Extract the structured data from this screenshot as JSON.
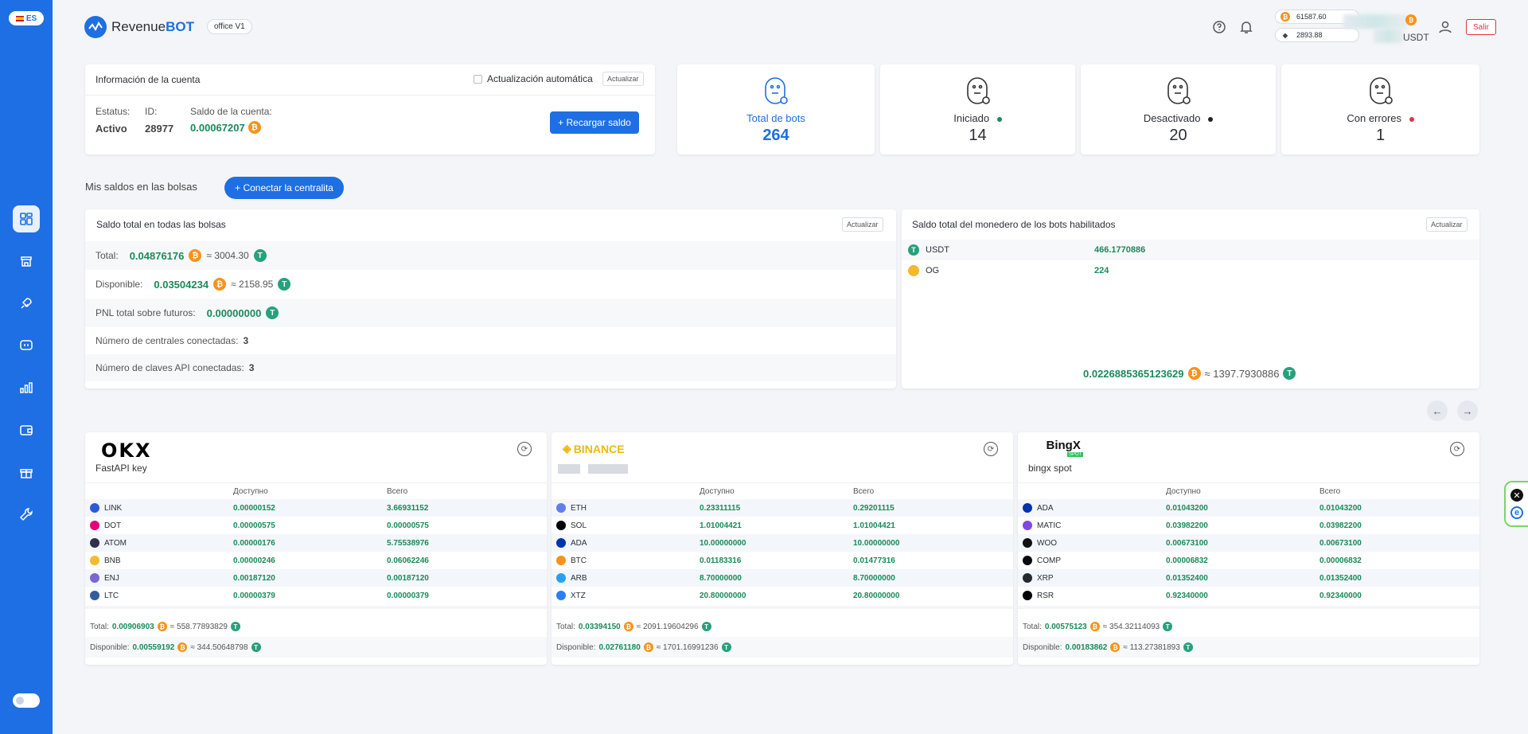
{
  "sidebar": {
    "lang": "ES",
    "items": [
      "dashboard",
      "store",
      "bots",
      "terminal",
      "statistics",
      "wallet",
      "gift",
      "tools"
    ]
  },
  "header": {
    "logo_text": "Revenue",
    "logo_bold": "BOT",
    "office": "office V1",
    "btc_price": "61587.60",
    "eth_price": "2893.88",
    "currency": "USDT",
    "logout": "Salir"
  },
  "account": {
    "title": "Información de la cuenta",
    "auto_update": "Actualización automática",
    "refresh": "Actualizar",
    "status_label": "Estatus:",
    "status": "Activo",
    "id_label": "ID:",
    "id": "28977",
    "balance_label": "Saldo de la cuenta:",
    "balance": "0.00067207",
    "topup": "+ Recargar saldo"
  },
  "bots": [
    {
      "label": "Total de bots",
      "value": "264",
      "dot": ""
    },
    {
      "label": "Iniciado",
      "value": "14",
      "dot": "#1a8a5a"
    },
    {
      "label": "Desactivado",
      "value": "20",
      "dot": "#222"
    },
    {
      "label": "Con errores",
      "value": "1",
      "dot": "#e2343f"
    }
  ],
  "balances": {
    "section_title": "Mis saldos en las bolsas",
    "connect": "+ Conectar la centralita",
    "total_title": "Saldo total en todas las bolsas",
    "refresh": "Actualizar",
    "total_label": "Total:",
    "total_btc": "0.04876176",
    "total_usdt": "≈ 3004.30",
    "avail_label": "Disponible:",
    "avail_btc": "0.03504234",
    "avail_usdt": "≈ 2158.95",
    "pnl_label": "PNL total sobre futuros:",
    "pnl": "0.00000000",
    "exchanges_label": "Número de centrales conectadas:",
    "exchanges": "3",
    "keys_label": "Número de claves API conectadas:",
    "keys": "3"
  },
  "wallet": {
    "title": "Saldo total del monedero de los bots habilitados",
    "refresh": "Actualizar",
    "rows": [
      {
        "coin": "USDT",
        "value": "466.1770886"
      },
      {
        "coin": "OG",
        "value": "224"
      }
    ],
    "total_btc": "0.0226885365123629",
    "total_usdt": "≈ 1397.7930886"
  },
  "exchanges": [
    {
      "brand": "OKX",
      "name": "FastAPI key",
      "head_avail": "Доступно",
      "head_total": "Всего",
      "rows": [
        {
          "coin": "LINK",
          "avail": "0.00000152",
          "total": "3.66931152",
          "color": "#2a5ada"
        },
        {
          "coin": "DOT",
          "avail": "0.00000575",
          "total": "0.00000575",
          "color": "#e6007a"
        },
        {
          "coin": "ATOM",
          "avail": "0.00000176",
          "total": "5.75538976",
          "color": "#2e3148"
        },
        {
          "coin": "BNB",
          "avail": "0.00000246",
          "total": "0.06062246",
          "color": "#f3ba2f"
        },
        {
          "coin": "ENJ",
          "avail": "0.00187120",
          "total": "0.00187120",
          "color": "#7866d5"
        },
        {
          "coin": "LTC",
          "avail": "0.00000379",
          "total": "0.00000379",
          "color": "#345d9d"
        }
      ],
      "total_label": "Total:",
      "total_btc": "0.00906903",
      "total_usdt": "≈ 558.77893829",
      "avail_label": "Disponible:",
      "avail_btc": "0.00559192",
      "avail_usdt": "≈ 344.50648798"
    },
    {
      "brand": "BINANCE",
      "name": "",
      "head_avail": "Доступно",
      "head_total": "Всего",
      "rows": [
        {
          "coin": "ETH",
          "avail": "0.23311115",
          "total": "0.29201115",
          "color": "#627eea"
        },
        {
          "coin": "SOL",
          "avail": "1.01004421",
          "total": "1.01004421",
          "color": "#000"
        },
        {
          "coin": "ADA",
          "avail": "10.00000000",
          "total": "10.00000000",
          "color": "#0033ad"
        },
        {
          "coin": "BTC",
          "avail": "0.01183316",
          "total": "0.01477316",
          "color": "#f7931a"
        },
        {
          "coin": "ARB",
          "avail": "8.70000000",
          "total": "8.70000000",
          "color": "#28a0f0"
        },
        {
          "coin": "XTZ",
          "avail": "20.80000000",
          "total": "20.80000000",
          "color": "#2c7df7"
        }
      ],
      "total_label": "Total:",
      "total_btc": "0.03394150",
      "total_usdt": "≈ 2091.19604296",
      "avail_label": "Disponible:",
      "avail_btc": "0.02761180",
      "avail_usdt": "≈ 1701.16991236"
    },
    {
      "brand": "BingX",
      "brand_sub": "SPOT",
      "name": "bingx spot",
      "head_avail": "Доступно",
      "head_total": "Всего",
      "rows": [
        {
          "coin": "ADA",
          "avail": "0.01043200",
          "total": "0.01043200",
          "color": "#0033ad"
        },
        {
          "coin": "MATIC",
          "avail": "0.03982200",
          "total": "0.03982200",
          "color": "#8247e5"
        },
        {
          "coin": "WOO",
          "avail": "0.00673100",
          "total": "0.00673100",
          "color": "#111"
        },
        {
          "coin": "COMP",
          "avail": "0.00006832",
          "total": "0.00006832",
          "color": "#070a0e"
        },
        {
          "coin": "XRP",
          "avail": "0.01352400",
          "total": "0.01352400",
          "color": "#23292f"
        },
        {
          "coin": "RSR",
          "avail": "0.92340000",
          "total": "0.92340000",
          "color": "#000"
        }
      ],
      "total_label": "Total:",
      "total_btc": "0.00575123",
      "total_usdt": "≈ 354.32114093",
      "avail_label": "Disponible:",
      "avail_btc": "0.00183862",
      "avail_usdt": "≈ 113.27381893"
    }
  ],
  "colors": {
    "primary": "#1e6fe3",
    "green": "#1a8a5a",
    "btc": "#f7931a",
    "usdt": "#26a17b",
    "danger": "#e2343f"
  }
}
